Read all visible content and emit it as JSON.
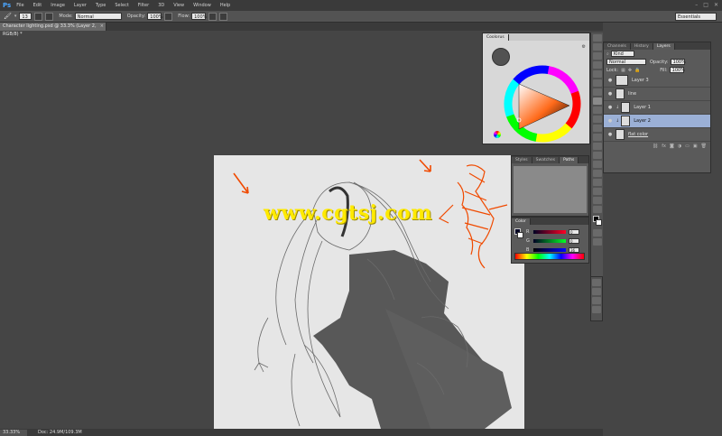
{
  "app": {
    "logo": "Ps"
  },
  "menu": [
    "File",
    "Edit",
    "Image",
    "Layer",
    "Type",
    "Select",
    "Filter",
    "3D",
    "View",
    "Window",
    "Help"
  ],
  "options": {
    "mode_label": "Mode:",
    "mode_value": "Normal",
    "opacity_label": "Opacity:",
    "opacity_value": "100%",
    "flow_label": "Flow:",
    "flow_value": "100%",
    "brush_size": "13"
  },
  "workspace": "Essentials",
  "document": {
    "tab_title": "Character lighting.psd @ 33.3% (Layer 2, RGB/8) *",
    "close": "×"
  },
  "status": {
    "zoom": "33.33%",
    "doc_info": "Doc: 24.9M/109.3M"
  },
  "watermark": "www.cgtsj.com",
  "coolorus": {
    "tab": "Coolorus"
  },
  "layers_panel": {
    "tabs": [
      "Channels",
      "History",
      "Layers"
    ],
    "kind_label": "Kind",
    "blend_mode": "Normal",
    "opacity_label": "Opacity:",
    "opacity_value": "100%",
    "lock_label": "Lock:",
    "fill_label": "Fill:",
    "fill_value": "100%",
    "rows": [
      {
        "name": "Layer 3",
        "selected": false
      },
      {
        "name": "line",
        "selected": false
      },
      {
        "name": "Layer 1",
        "selected": false
      },
      {
        "name": "Layer 2",
        "selected": true
      },
      {
        "name": "flat color",
        "selected": false
      }
    ]
  },
  "styles_panel": {
    "tabs": [
      "Styles",
      "Swatches",
      "Paths"
    ]
  },
  "color_panel": {
    "tab": "Color",
    "sliders": [
      {
        "label": "R",
        "value": "0"
      },
      {
        "label": "G",
        "value": "0"
      },
      {
        "label": "B",
        "value": "36"
      }
    ]
  },
  "colors": {
    "accent_orange": "#f04a00",
    "selected_layer": "#9bb0d6",
    "canvas": "#e6e6e6",
    "watermark": "#ffea00"
  }
}
